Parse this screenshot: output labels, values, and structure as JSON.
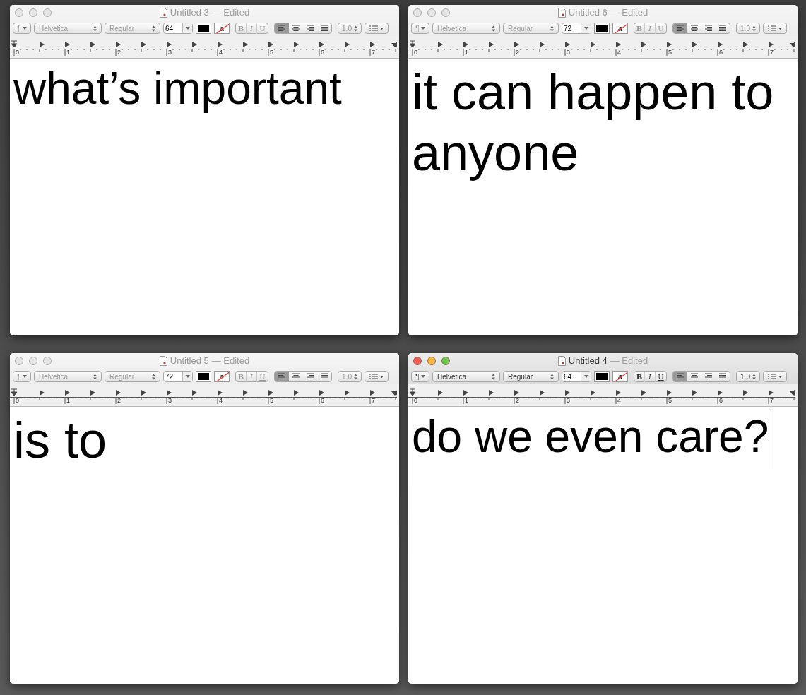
{
  "windows": [
    {
      "title": "Untitled 3",
      "status": "— Edited",
      "active": false,
      "paragraph": "¶",
      "font": "Helvetica",
      "style": "Regular",
      "size": "64",
      "highlight": "a",
      "bold": "B",
      "italic": "I",
      "underline": "U",
      "spacing": "1.0",
      "ruler_labels": [
        "0",
        "1",
        "2",
        "3",
        "4",
        "5",
        "6",
        "7"
      ],
      "text": "what’s important",
      "caret": false
    },
    {
      "title": "Untitled 6",
      "status": "— Edited",
      "active": false,
      "paragraph": "¶",
      "font": "Helvetica",
      "style": "Regular",
      "size": "72",
      "highlight": "a",
      "bold": "B",
      "italic": "I",
      "underline": "U",
      "spacing": "1.0",
      "ruler_labels": [
        "0",
        "1",
        "2",
        "3",
        "4",
        "5",
        "6",
        "7"
      ],
      "text": "it can happen to anyone",
      "caret": false
    },
    {
      "title": "Untitled 5",
      "status": "— Edited",
      "active": false,
      "paragraph": "¶",
      "font": "Helvetica",
      "style": "Regular",
      "size": "72",
      "highlight": "a",
      "bold": "B",
      "italic": "I",
      "underline": "U",
      "spacing": "1.0",
      "ruler_labels": [
        "0",
        "1",
        "2",
        "3",
        "4",
        "5",
        "6",
        "7"
      ],
      "text": "is to",
      "caret": false
    },
    {
      "title": "Untitled 4",
      "status": "— Edited",
      "active": true,
      "paragraph": "¶",
      "font": "Helvetica",
      "style": "Regular",
      "size": "64",
      "highlight": "a",
      "bold": "B",
      "italic": "I",
      "underline": "U",
      "spacing": "1.0",
      "ruler_labels": [
        "0",
        "1",
        "2",
        "3",
        "4",
        "5",
        "6",
        "7"
      ],
      "text": "do we even care?",
      "caret": true
    }
  ]
}
